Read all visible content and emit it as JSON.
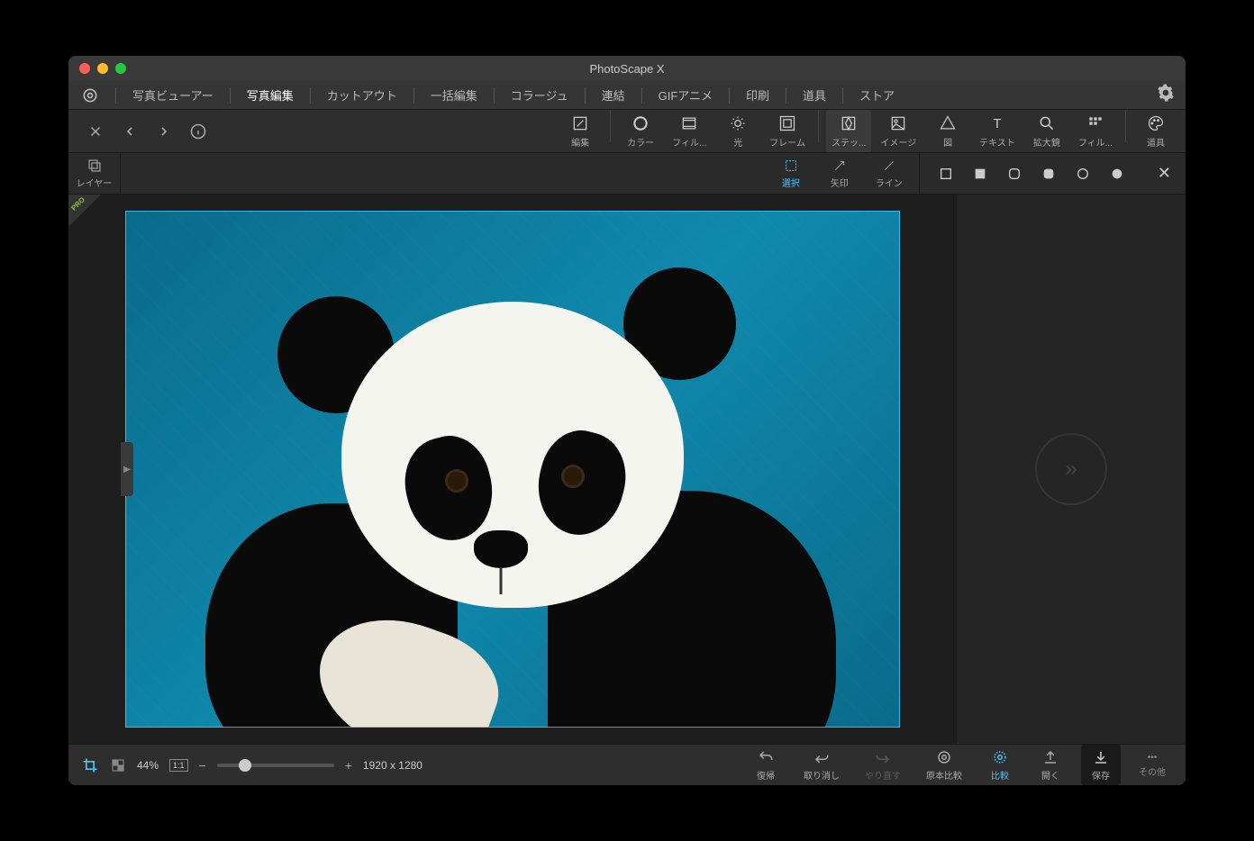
{
  "title": "PhotoScape X",
  "menu": {
    "items": [
      "写真ビューアー",
      "写真編集",
      "カットアウト",
      "一括編集",
      "コラージュ",
      "連結",
      "GIFアニメ",
      "印刷",
      "道具",
      "ストア"
    ],
    "active_index": 1
  },
  "tools": {
    "row1": [
      {
        "label": "編集",
        "icon": "edit"
      },
      {
        "label": "カラー",
        "icon": "color"
      },
      {
        "label": "フィル...",
        "icon": "film"
      },
      {
        "label": "光",
        "icon": "light"
      },
      {
        "label": "フレーム",
        "icon": "frame"
      },
      {
        "label": "ステッ...",
        "icon": "sticker",
        "sel": true
      },
      {
        "label": "イメージ",
        "icon": "image"
      },
      {
        "label": "図",
        "icon": "shape"
      },
      {
        "label": "テキスト",
        "icon": "text"
      },
      {
        "label": "拡大鏡",
        "icon": "magnify"
      },
      {
        "label": "フィル...",
        "icon": "filter"
      },
      {
        "label": "道具",
        "icon": "palette"
      }
    ]
  },
  "subtools": {
    "layers_label": "レイヤー",
    "items": [
      {
        "label": "選択",
        "active": true
      },
      {
        "label": "矢印",
        "active": false
      },
      {
        "label": "ライン",
        "active": false
      }
    ]
  },
  "pro_badge": "PRO",
  "status": {
    "zoom": "44%",
    "onetoone": "1:1",
    "dimensions": "1920 x 1280",
    "actions": [
      {
        "label": "復帰",
        "icon": "revert"
      },
      {
        "label": "取り消し",
        "icon": "undo"
      },
      {
        "label": "やり直す",
        "icon": "redo",
        "disabled": true
      },
      {
        "label": "原本比較",
        "icon": "original"
      },
      {
        "label": "比較",
        "icon": "compare",
        "hl": true
      },
      {
        "label": "開く",
        "icon": "open"
      },
      {
        "label": "保存",
        "icon": "save",
        "dk": true
      }
    ],
    "more_label": "その他"
  }
}
